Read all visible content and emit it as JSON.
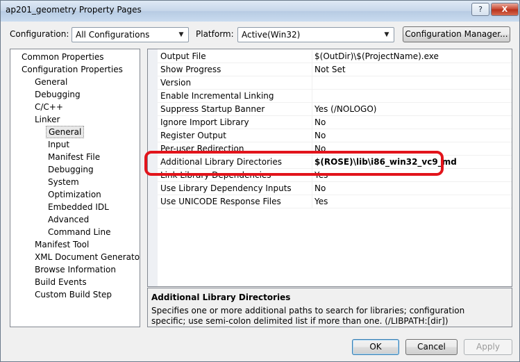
{
  "window": {
    "title": "ap201_geometry Property Pages",
    "help_button": "?",
    "close_button": "X"
  },
  "toolbar": {
    "configuration_label": "Configuration:",
    "configuration_value": "All Configurations",
    "platform_label": "Platform:",
    "platform_value": "Active(Win32)",
    "config_manager_label": "Configuration Manager..."
  },
  "tree": {
    "items": [
      {
        "label": "Common Properties"
      },
      {
        "label": "Configuration Properties"
      },
      {
        "label": "General"
      },
      {
        "label": "Debugging"
      },
      {
        "label": "C/C++"
      },
      {
        "label": "Linker"
      },
      {
        "label": "General",
        "selected": true
      },
      {
        "label": "Input"
      },
      {
        "label": "Manifest File"
      },
      {
        "label": "Debugging"
      },
      {
        "label": "System"
      },
      {
        "label": "Optimization"
      },
      {
        "label": "Embedded IDL"
      },
      {
        "label": "Advanced"
      },
      {
        "label": "Command Line"
      },
      {
        "label": "Manifest Tool"
      },
      {
        "label": "XML Document Generator"
      },
      {
        "label": "Browse Information"
      },
      {
        "label": "Build Events"
      },
      {
        "label": "Custom Build Step"
      }
    ]
  },
  "properties": [
    {
      "name": "Output File",
      "value": "$(OutDir)\\$(ProjectName).exe"
    },
    {
      "name": "Show Progress",
      "value": "Not Set"
    },
    {
      "name": "Version",
      "value": ""
    },
    {
      "name": "Enable Incremental Linking",
      "value": ""
    },
    {
      "name": "Suppress Startup Banner",
      "value": "Yes (/NOLOGO)"
    },
    {
      "name": "Ignore Import Library",
      "value": "No"
    },
    {
      "name": "Register Output",
      "value": "No"
    },
    {
      "name": "Per-user Redirection",
      "value": "No"
    },
    {
      "name": "Additional Library Directories",
      "value": "$(ROSE)\\lib\\i86_win32_vc9_md",
      "bold": true,
      "highlighted": true
    },
    {
      "name": "Link Library Dependencies",
      "value": "Yes"
    },
    {
      "name": "Use Library Dependency Inputs",
      "value": "No"
    },
    {
      "name": "Use UNICODE Response Files",
      "value": "Yes"
    }
  ],
  "description": {
    "title": "Additional Library Directories",
    "text": "Specifies one or more additional paths to search for libraries; configuration specific; use semi-colon delimited list if more than one.     (/LIBPATH:[dir])"
  },
  "buttons": {
    "ok": "OK",
    "cancel": "Cancel",
    "apply": "Apply"
  },
  "colors": {
    "highlight_border": "#e2141b"
  }
}
